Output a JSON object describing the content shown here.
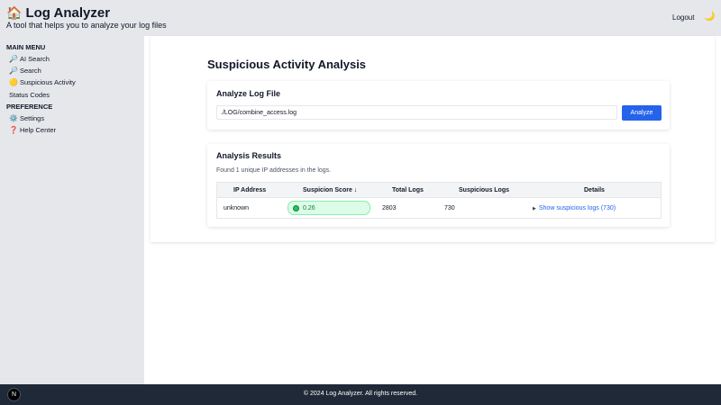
{
  "header": {
    "title": "Log Analyzer",
    "subtitle": "A tool that helps you to analyze your log files",
    "home_icon": "🏠",
    "logout_label": "Logout",
    "theme_icon": "🌙"
  },
  "sidebar": {
    "main_menu_title": "MAIN MENU",
    "items": [
      {
        "icon": "🔎",
        "label": "AI Search"
      },
      {
        "icon": "🔎",
        "label": "Search"
      },
      {
        "icon": "🟡",
        "label": "Suspicious Activity"
      },
      {
        "icon": "",
        "label": "Status Codes"
      }
    ],
    "preference_title": "PREFERENCE",
    "pref_items": [
      {
        "icon": "⚙️",
        "label": "Settings"
      },
      {
        "icon": "❓",
        "label": "Help Center"
      }
    ]
  },
  "main": {
    "page_title": "Suspicious Activity Analysis",
    "analyze": {
      "title": "Analyze Log File",
      "file_path": "./LOG/combine_access.log",
      "button_label": "Analyze"
    },
    "results": {
      "title": "Analysis Results",
      "found_text": "Found 1 unique IP addresses in the logs.",
      "columns": [
        "IP Address",
        "Suspicion Score ↓",
        "Total Logs",
        "Suspicious Logs",
        "Details"
      ],
      "rows": [
        {
          "ip": "unknown",
          "score": "0.26",
          "total_logs": "2803",
          "suspicious_logs": "730",
          "details": "Show suspicious logs (730)"
        }
      ]
    }
  },
  "footer": {
    "text": "© 2024 Log Analyzer. All rights reserved.",
    "badge": "N"
  },
  "colors": {
    "accent": "#2563eb",
    "score_bg": "#dcfce7",
    "score_text": "#15803d",
    "footer_bg": "#1f2937"
  }
}
